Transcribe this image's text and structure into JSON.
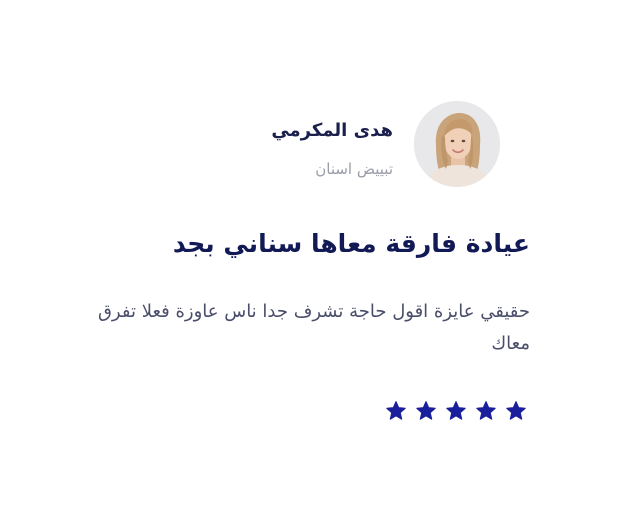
{
  "review": {
    "reviewer_name": "هدى المكرمي",
    "service": "تبييض اسنان",
    "title": "عيادة فارقة معاها سناني بجد",
    "text": "حقيقي عايزة اقول حاجة تشرف جدا ناس عاوزة فعلا تفرق معاك",
    "rating": 5,
    "rating_max": 5
  },
  "icons": {
    "avatar": "reviewer-photo",
    "star": "star-icon"
  },
  "colors": {
    "star": "#1a1f9c",
    "title": "#121a55",
    "name": "#1b1f4b",
    "muted": "#9a9ca8",
    "body_text": "#4a4e6a"
  }
}
